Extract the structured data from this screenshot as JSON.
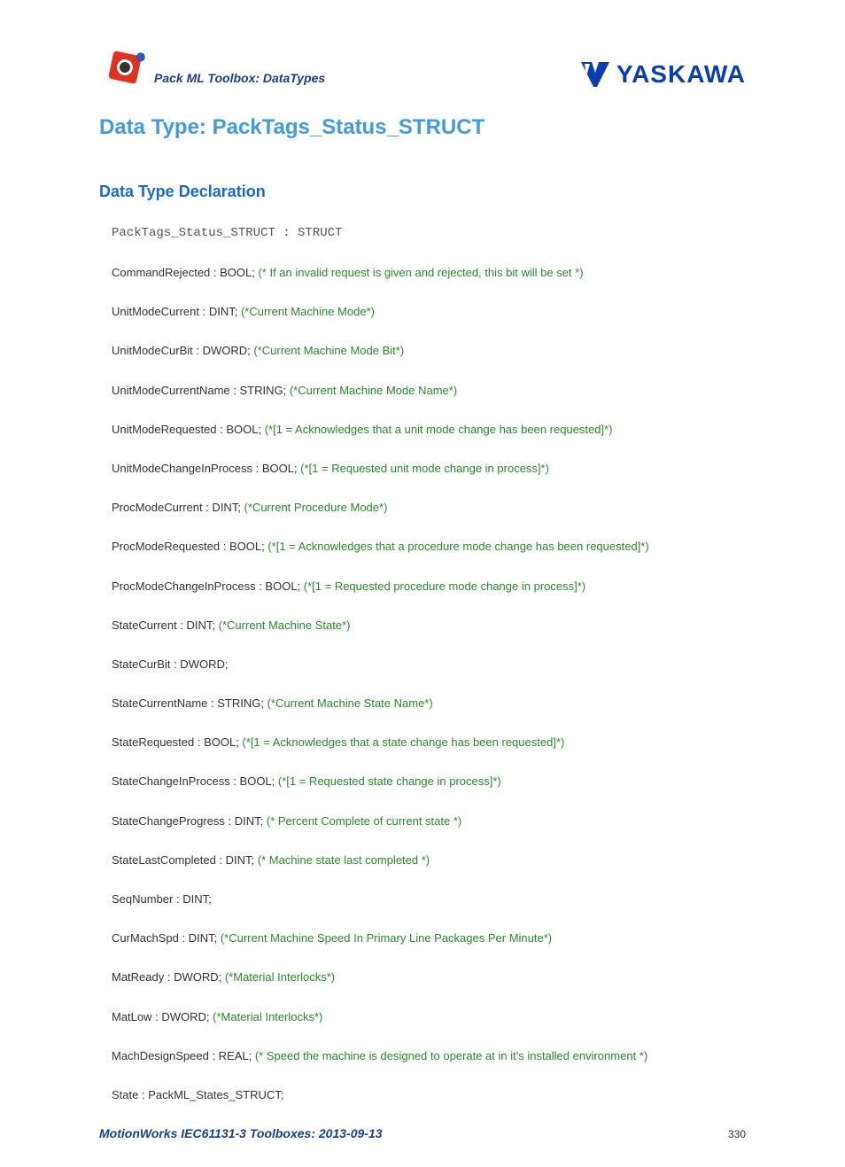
{
  "header": {
    "brand": "Pack ML Toolbox: DataTypes",
    "company": "YASKAWA"
  },
  "page_title": "Data Type: PackTags_Status_STRUCT",
  "section_title": "Data Type Declaration",
  "struct_decl": "PackTags_Status_STRUCT :   STRUCT",
  "members": [
    {
      "decl": "CommandRejected : BOOL; ",
      "comment": "(* If an invalid request is given and rejected, this bit will be set *)"
    },
    {
      "decl": "UnitModeCurrent : DINT; ",
      "comment": "(*Current Machine Mode*)"
    },
    {
      "decl": "UnitModeCurBit : DWORD; ",
      "comment": "(*Current Machine Mode Bit*)"
    },
    {
      "decl": "UnitModeCurrentName : STRING; ",
      "comment": "(*Current Machine Mode Name*)"
    },
    {
      "decl": "UnitModeRequested : BOOL; ",
      "comment": "(*[1 = Acknowledges that a unit mode change has been requested]*)"
    },
    {
      "decl": "UnitModeChangeInProcess : BOOL; ",
      "comment": "(*[1 = Requested unit mode change in process]*)"
    },
    {
      "decl": "ProcModeCurrent : DINT; ",
      "comment": "(*Current Procedure Mode*)"
    },
    {
      "decl": "ProcModeRequested : BOOL; ",
      "comment": "(*[1 = Acknowledges that a procedure mode change has been requested]*)"
    },
    {
      "decl": "ProcModeChangeInProcess : BOOL; ",
      "comment": "(*[1 = Requested procedure mode change in process]*)"
    },
    {
      "decl": "StateCurrent : DINT; ",
      "comment": "(*Current Machine State*)"
    },
    {
      "decl": "StateCurBit : DWORD;",
      "comment": ""
    },
    {
      "decl": "StateCurrentName : STRING; ",
      "comment": "(*Current Machine State Name*)"
    },
    {
      "decl": "StateRequested : BOOL; ",
      "comment": "(*[1 = Acknowledges that a state change has been requested]*)"
    },
    {
      "decl": "StateChangeInProcess : BOOL; ",
      "comment": "(*[1 = Requested state change in process]*)"
    },
    {
      "decl": "StateChangeProgress : DINT; ",
      "comment": "(* Percent Complete of current state *)"
    },
    {
      "decl": "StateLastCompleted : DINT; ",
      "comment": "(* Machine state last completed *)"
    },
    {
      "decl": "SeqNumber : DINT;",
      "comment": ""
    },
    {
      "decl": "CurMachSpd : DINT; ",
      "comment": "(*Current Machine Speed In Primary Line Packages Per Minute*)"
    },
    {
      "decl": "MatReady : DWORD; ",
      "comment": "(*Material Interlocks*)"
    },
    {
      "decl": "MatLow : DWORD; ",
      "comment": "(*Material Interlocks*)"
    },
    {
      "decl": "MachDesignSpeed : REAL; ",
      "comment": "(* Speed the machine is designed to operate at in it's installed environment *)"
    },
    {
      "decl": "State : PackML_States_STRUCT;",
      "comment": ""
    }
  ],
  "footer": {
    "text": "MotionWorks IEC61131-3 Toolboxes: 2013-09-13",
    "page": "330"
  }
}
